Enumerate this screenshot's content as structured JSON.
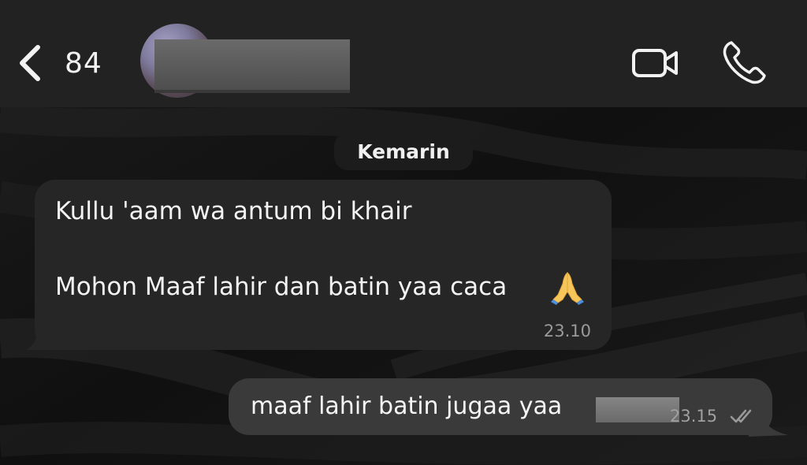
{
  "header": {
    "back_count": "84",
    "contact_name": "",
    "icons": [
      "chevron-left-icon",
      "video-camera-icon",
      "phone-icon"
    ]
  },
  "chat": {
    "date_separator": "Kemarin",
    "messages": [
      {
        "direction": "incoming",
        "lines": [
          "Kullu 'aam wa antum bi khair",
          "Mohon Maaf lahir dan batin yaa caca"
        ],
        "emoji": "folded-hands",
        "time": "23.10"
      },
      {
        "direction": "outgoing",
        "text": "maaf lahir batin jugaa yaa",
        "time": "23.15",
        "status": "read"
      }
    ]
  },
  "colors": {
    "header_bg": "#222222",
    "incoming_bubble": "#262626",
    "outgoing_bubble": "#3a3a3a",
    "text": "#f3f3f3",
    "timestamp": "#9a9a9a"
  }
}
